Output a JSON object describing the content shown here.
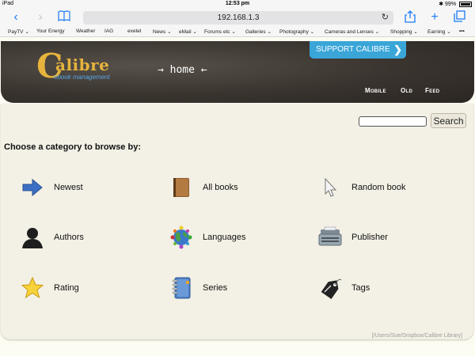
{
  "status": {
    "device": "iPad",
    "time": "12:53 pm",
    "battery": "99%"
  },
  "browser": {
    "url": "192.168.1.3",
    "bookmarks": [
      "PayTV",
      "Your Energy",
      "Weather",
      "IAG",
      "exetel",
      "News",
      "eMail",
      "Forums etc",
      "Galleries",
      "Photography",
      "Cameras and Lenses",
      "Shopping",
      "Earning"
    ]
  },
  "header": {
    "logo_text": "alibre",
    "logo_sub": "ebook management",
    "title": "→ home ←",
    "support_label": "SUPPORT CALIBRE",
    "links": {
      "mobile": "Mobile",
      "old": "Old",
      "feed": "Feed"
    }
  },
  "search": {
    "button_label": "Search"
  },
  "prompt": "Choose a category to browse by:",
  "categories": [
    {
      "label": "Newest",
      "icon": "arrow-right-icon"
    },
    {
      "label": "All books",
      "icon": "book-icon"
    },
    {
      "label": "Random book",
      "icon": "cursor-icon"
    },
    {
      "label": "Authors",
      "icon": "person-icon"
    },
    {
      "label": "Languages",
      "icon": "globe-icon"
    },
    {
      "label": "Publisher",
      "icon": "typewriter-icon"
    },
    {
      "label": "Rating",
      "icon": "star-icon"
    },
    {
      "label": "Series",
      "icon": "notebook-icon"
    },
    {
      "label": "Tags",
      "icon": "tag-icon"
    }
  ],
  "library_path": "[/Users/Sue/Dropbox/Calibre Library]"
}
